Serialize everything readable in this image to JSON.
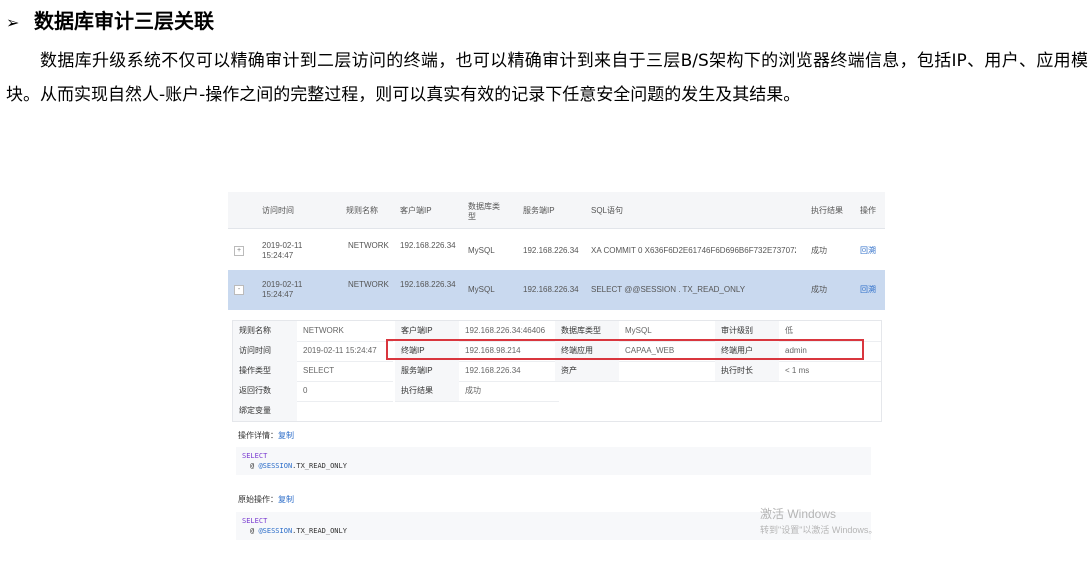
{
  "heading": {
    "bullet": "➢",
    "title": "数据库审计三层关联"
  },
  "paragraph": "数据库升级系统不仅可以精确审计到二层访问的终端，也可以精确审计到来自于三层B/S架构下的浏览器终端信息，包括IP、用户、应用模块。从而实现自然人-账户-操作之间的完整过程，则可以真实有效的记录下任意安全问题的发生及其结果。",
  "table": {
    "headers": [
      "访问时间",
      "规则名称",
      "客户端IP",
      "数据库类型",
      "服务端IP",
      "SQL语句",
      "执行结果",
      "操作"
    ],
    "rows": [
      {
        "expand": "+",
        "time": "2019-02-11 15:24:47",
        "rule": "NETWORK",
        "client_ip": "192.168.226.34",
        "db_type": "MySQL",
        "server_ip": "192.168.226.34",
        "sql": "XA COMMIT 0 X636F6D2E61746F6D696B6F732E737072696...",
        "result": "成功",
        "action": "回溯"
      },
      {
        "expand": "-",
        "time": "2019-02-11 15:24:47",
        "rule": "NETWORK",
        "client_ip": "192.168.226.34",
        "db_type": "MySQL",
        "server_ip": "192.168.226.34",
        "sql": "SELECT @@SESSION . TX_READ_ONLY",
        "result": "成功",
        "action": "回溯"
      }
    ]
  },
  "detail": {
    "rule_label": "规则名称",
    "rule_value": "NETWORK",
    "client_ip_label": "客户端IP",
    "client_ip_value": "192.168.226.34:46406",
    "db_type_label": "数据库类型",
    "db_type_value": "MySQL",
    "audit_level_label": "审计级别",
    "audit_level_value": "低",
    "access_time_label": "访问时间",
    "access_time_value": "2019-02-11 15:24:47",
    "terminal_ip_label": "终端IP",
    "terminal_ip_value": "192.168.98.214",
    "terminal_app_label": "终端应用",
    "terminal_app_value": "CAPAA_WEB",
    "terminal_user_label": "终端用户",
    "terminal_user_value": "admin",
    "op_type_label": "操作类型",
    "op_type_value": "SELECT",
    "server_ip_label": "服务端IP",
    "server_ip_value": "192.168.226.34",
    "asset_label": "资产",
    "asset_value": "",
    "exec_time_label": "执行时长",
    "exec_time_value": "< 1 ms",
    "rows_label": "返回行数",
    "rows_value": "0",
    "exec_result_label": "执行结果",
    "exec_result_value": "成功",
    "bind_label": "绑定变量",
    "bind_value": ""
  },
  "op_detail": {
    "label": "操作详情：",
    "copy": "复制",
    "kw": "SELECT",
    "line2_at": "@ ",
    "line2_var": "@SESSION",
    "line2_rest": ".TX_READ_ONLY"
  },
  "raw_op": {
    "label": "原始操作：",
    "copy": "复制",
    "kw": "SELECT",
    "line2_at": "@ ",
    "line2_var": "@SESSION",
    "line2_rest": ".TX_READ_ONLY"
  },
  "watermark": {
    "line1": "激活 Windows",
    "line2": "转到\"设置\"以激活 Windows。"
  }
}
